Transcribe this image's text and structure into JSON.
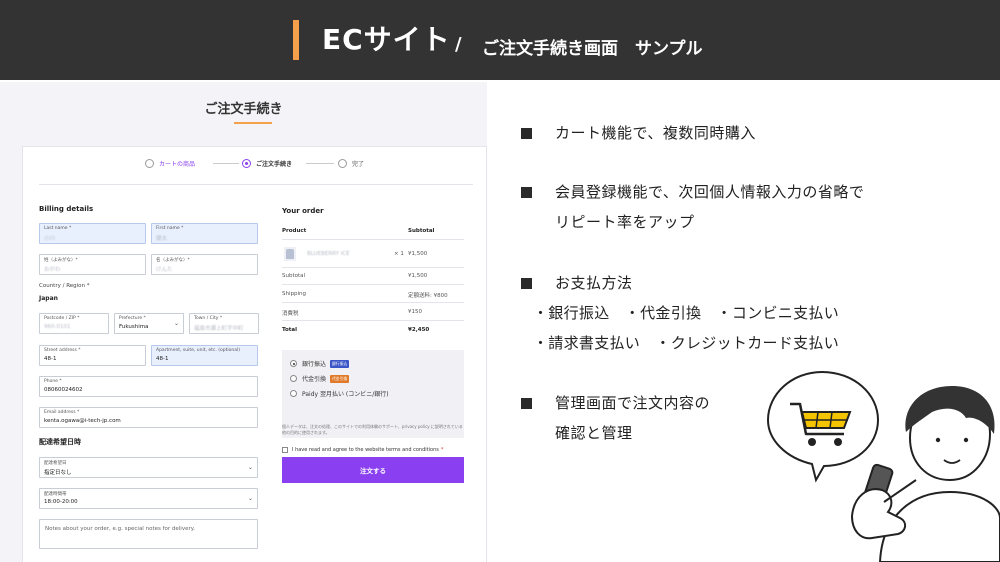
{
  "banner": {
    "title": "ECサイト",
    "slash": "/",
    "subtitle": "ご注文手続き画面　サンプル",
    "accent_color": "#f5a04a",
    "bg_color": "#333333"
  },
  "checkout": {
    "page_title": "ご注文手続き",
    "steps": [
      {
        "label": "カートの商品"
      },
      {
        "label": "ご注文手続き"
      },
      {
        "label": "完了"
      }
    ],
    "billing": {
      "heading": "Billing details",
      "last_name": {
        "label": "Last name *",
        "value": "小川"
      },
      "first_name": {
        "label": "First name *",
        "value": "健太"
      },
      "last_kana": {
        "label": "姓（よみがな）*",
        "value": "おがわ"
      },
      "first_kana": {
        "label": "名（よみがな）*",
        "value": "けんた"
      },
      "country_label": "Country / Region *",
      "country_value": "Japan",
      "postcode": {
        "label": "Postcode / ZIP *",
        "value": "960-0101"
      },
      "prefecture": {
        "label": "Prefecture *",
        "value": "Fukushima"
      },
      "town": {
        "label": "Town / City *",
        "value": "福島市瀬上町字中町"
      },
      "street": {
        "label": "Street address *",
        "value": "48-1"
      },
      "apartment": {
        "label": "Apartment, suite, unit, etc. (optional)",
        "value": "48-1"
      },
      "phone": {
        "label": "Phone *",
        "value": "08060024602"
      },
      "email": {
        "label": "Email address *",
        "value": "kenta.ogawa@i-tech-jp.com"
      }
    },
    "delivery": {
      "heading": "配達希望日時",
      "date": {
        "label": "配達希望日",
        "value": "指定日なし"
      },
      "time": {
        "label": "配達時間帯",
        "value": "18:00-20:00"
      },
      "notes_placeholder": "Notes about your order, e.g. special notes for delivery."
    },
    "order": {
      "heading": "Your order",
      "col_product": "Product",
      "col_subtotal": "Subtotal",
      "item_name": "BLUEBERRY ICE",
      "item_qty": "× 1",
      "item_price": "¥1,500",
      "rows": [
        {
          "label": "Subtotal",
          "value": "¥1,500"
        },
        {
          "label": "Shipping",
          "value": "定額送料: ¥800"
        },
        {
          "label": "消費税",
          "value": "¥150"
        },
        {
          "label": "Total",
          "value": "¥2,450"
        }
      ]
    },
    "payment": {
      "options": [
        {
          "label": "銀行振込",
          "badge": "銀行振込",
          "badge_color": "#3b55c8",
          "selected": true
        },
        {
          "label": "代金引換",
          "badge": "代金引換",
          "badge_color": "#e07a2a",
          "selected": false
        },
        {
          "label": "Paidy 翌月払い (コンビニ/銀行)",
          "badge": "",
          "badge_color": "",
          "selected": false
        }
      ],
      "note": "個人データは、注文の処理、このサイトでの利用体験のサポート、privacy policy に説明されている他の目的に使用されます。"
    },
    "agree_text": "I have read and agree to the website terms and conditions",
    "agree_req": "*",
    "order_button": "注文する",
    "accent_color": "#8a3ff0"
  },
  "features": {
    "items": [
      {
        "line1": "カート機能で、複数同時購入",
        "line2": ""
      },
      {
        "line1": "会員登録機能で、次回個人情報入力の省略で",
        "line2": "リピート率をアップ"
      },
      {
        "line1": "お支払方法",
        "line2": ""
      },
      {
        "line1": "管理画面で注文内容の",
        "line2": "確認と管理"
      }
    ],
    "payment_methods_row1": "・銀行振込　・代金引換　・コンビニ支払い",
    "payment_methods_row2": "・請求書支払い　・クレジットカード支払い"
  }
}
